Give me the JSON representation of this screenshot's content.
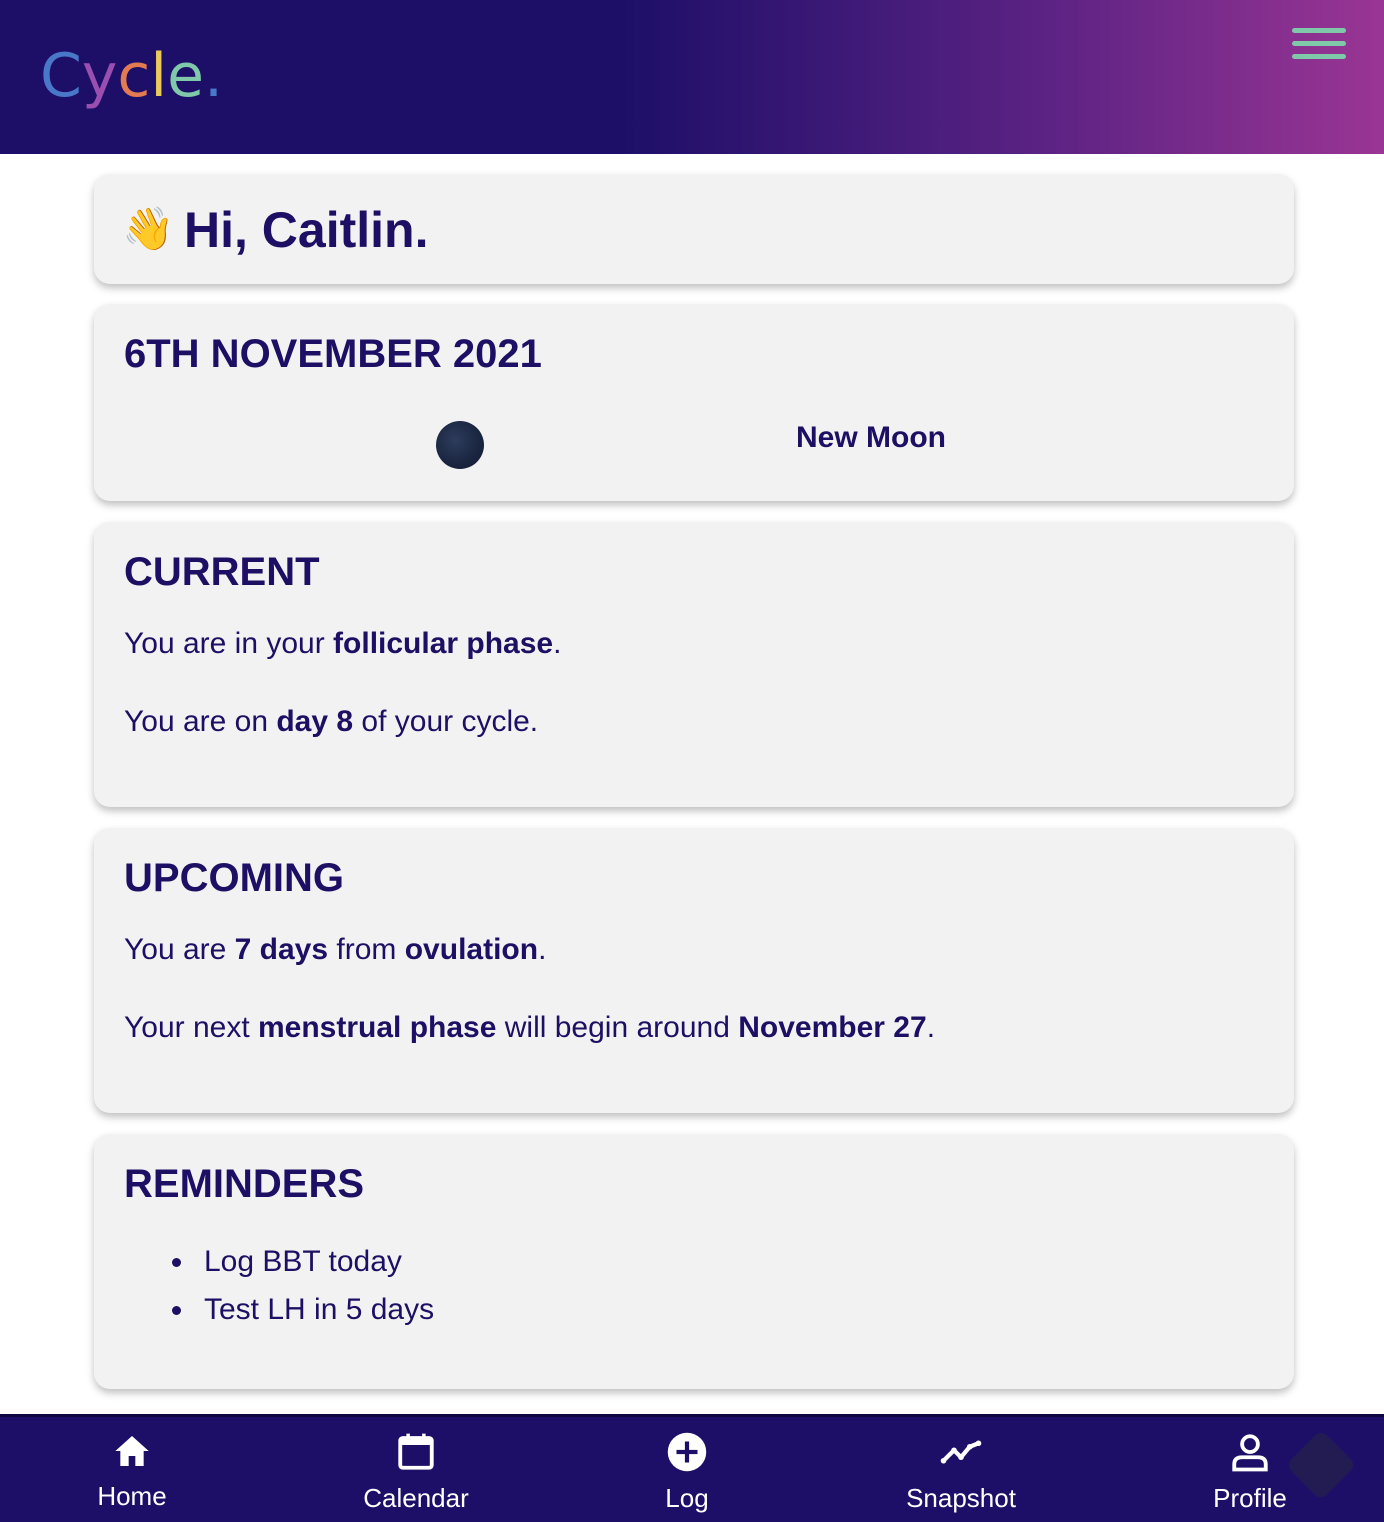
{
  "header": {
    "logo_letters": [
      {
        "char": "C",
        "color": "#4a78c8"
      },
      {
        "char": "y",
        "color": "#9a4fb0"
      },
      {
        "char": "c",
        "color": "#e27a52"
      },
      {
        "char": "l",
        "color": "#e8c95a"
      },
      {
        "char": "e",
        "color": "#7fc8a9"
      },
      {
        "char": ".",
        "color": "#4a78c8"
      }
    ],
    "menu_icon": "hamburger-icon"
  },
  "greeting": {
    "emoji": "👋",
    "text": "Hi, Caitlin."
  },
  "date_card": {
    "title": "6TH NOVEMBER 2021",
    "moon_phase": "New Moon"
  },
  "current": {
    "title": "CURRENT",
    "line1": {
      "pre": "You are in your ",
      "bold": "follicular phase",
      "post": "."
    },
    "line2": {
      "pre": "You are on ",
      "bold": "day 8",
      "post": " of your cycle."
    }
  },
  "upcoming": {
    "title": "UPCOMING",
    "line1": {
      "pre": "You are ",
      "bold1": "7 days",
      "mid": " from ",
      "bold2": "ovulation",
      "post": "."
    },
    "line2": {
      "pre": "Your next ",
      "bold1": "menstrual phase",
      "mid": " will begin around ",
      "bold2": "November 27",
      "post": "."
    }
  },
  "reminders": {
    "title": "REMINDERS",
    "items": [
      "Log BBT today",
      "Test LH in 5 days"
    ]
  },
  "nav": {
    "items": [
      {
        "label": "Home",
        "icon": "home-icon"
      },
      {
        "label": "Calendar",
        "icon": "calendar-icon"
      },
      {
        "label": "Log",
        "icon": "plus-circle-icon"
      },
      {
        "label": "Snapshot",
        "icon": "trend-line-icon"
      },
      {
        "label": "Profile",
        "icon": "person-icon"
      }
    ]
  }
}
